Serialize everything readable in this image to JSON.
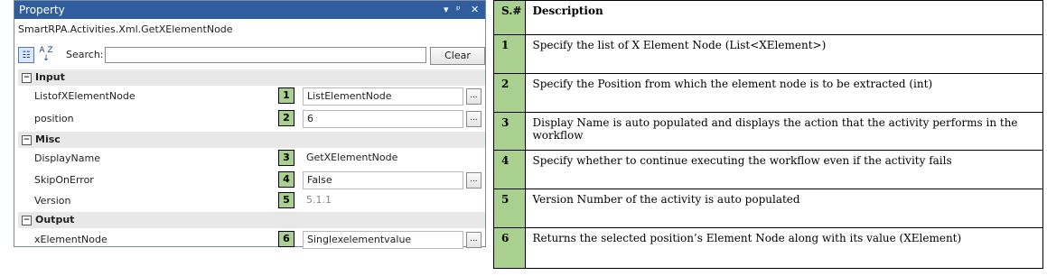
{
  "panel": {
    "title": "Property",
    "controls": [
      "▾",
      "ᵖ",
      "✕"
    ],
    "class_name": "SmartRPA.Activities.Xml.GetXElementNode",
    "search_label": "Search:",
    "search_value": "",
    "clear_label": "Clear",
    "sort_alpha_label": "A Z ↓",
    "categories": [
      {
        "name": "Input",
        "toggle": "−"
      },
      {
        "name": "Misc",
        "toggle": "−"
      },
      {
        "name": "Output",
        "toggle": "−"
      }
    ],
    "rows": [
      {
        "label": "ListofXElementNode",
        "badge": "1",
        "value": "ListElementNode",
        "editable": true
      },
      {
        "label": "position",
        "badge": "2",
        "value": "6",
        "editable": true
      },
      {
        "label": "DisplayName",
        "badge": "3",
        "value": "GetXElementNode",
        "editable": false
      },
      {
        "label": "SkipOnError",
        "badge": "4",
        "value": "False",
        "editable": true
      },
      {
        "label": "Version",
        "badge": "5",
        "value": "5.1.1",
        "editable": false
      },
      {
        "label": "xElementNode",
        "badge": "6",
        "value": "Singlexelementvalue",
        "editable": true
      }
    ],
    "ellipsis": "..."
  },
  "table": {
    "headers": [
      "S.#",
      "Description"
    ],
    "rows": [
      {
        "num": "1",
        "desc": "Specify the list of  X  Element Node (List<XElement>)"
      },
      {
        "num": "2",
        "desc": "Specify the Position from which the element node is to be extracted (int)"
      },
      {
        "num": "3",
        "desc": "Display Name is auto populated and displays the action that the activity performs in the workflow"
      },
      {
        "num": "4",
        "desc": "Specify whether to continue executing the workflow even if the activity fails"
      },
      {
        "num": "5",
        "desc": "Version Number of the activity is auto populated"
      },
      {
        "num": "6",
        "desc": "Returns the selected position’s  Element Node along with its value (XElement)"
      }
    ]
  },
  "colors": {
    "titlebar": "#2f5d9e",
    "badge": "#a9d08e",
    "category": "#e8e8e8"
  }
}
